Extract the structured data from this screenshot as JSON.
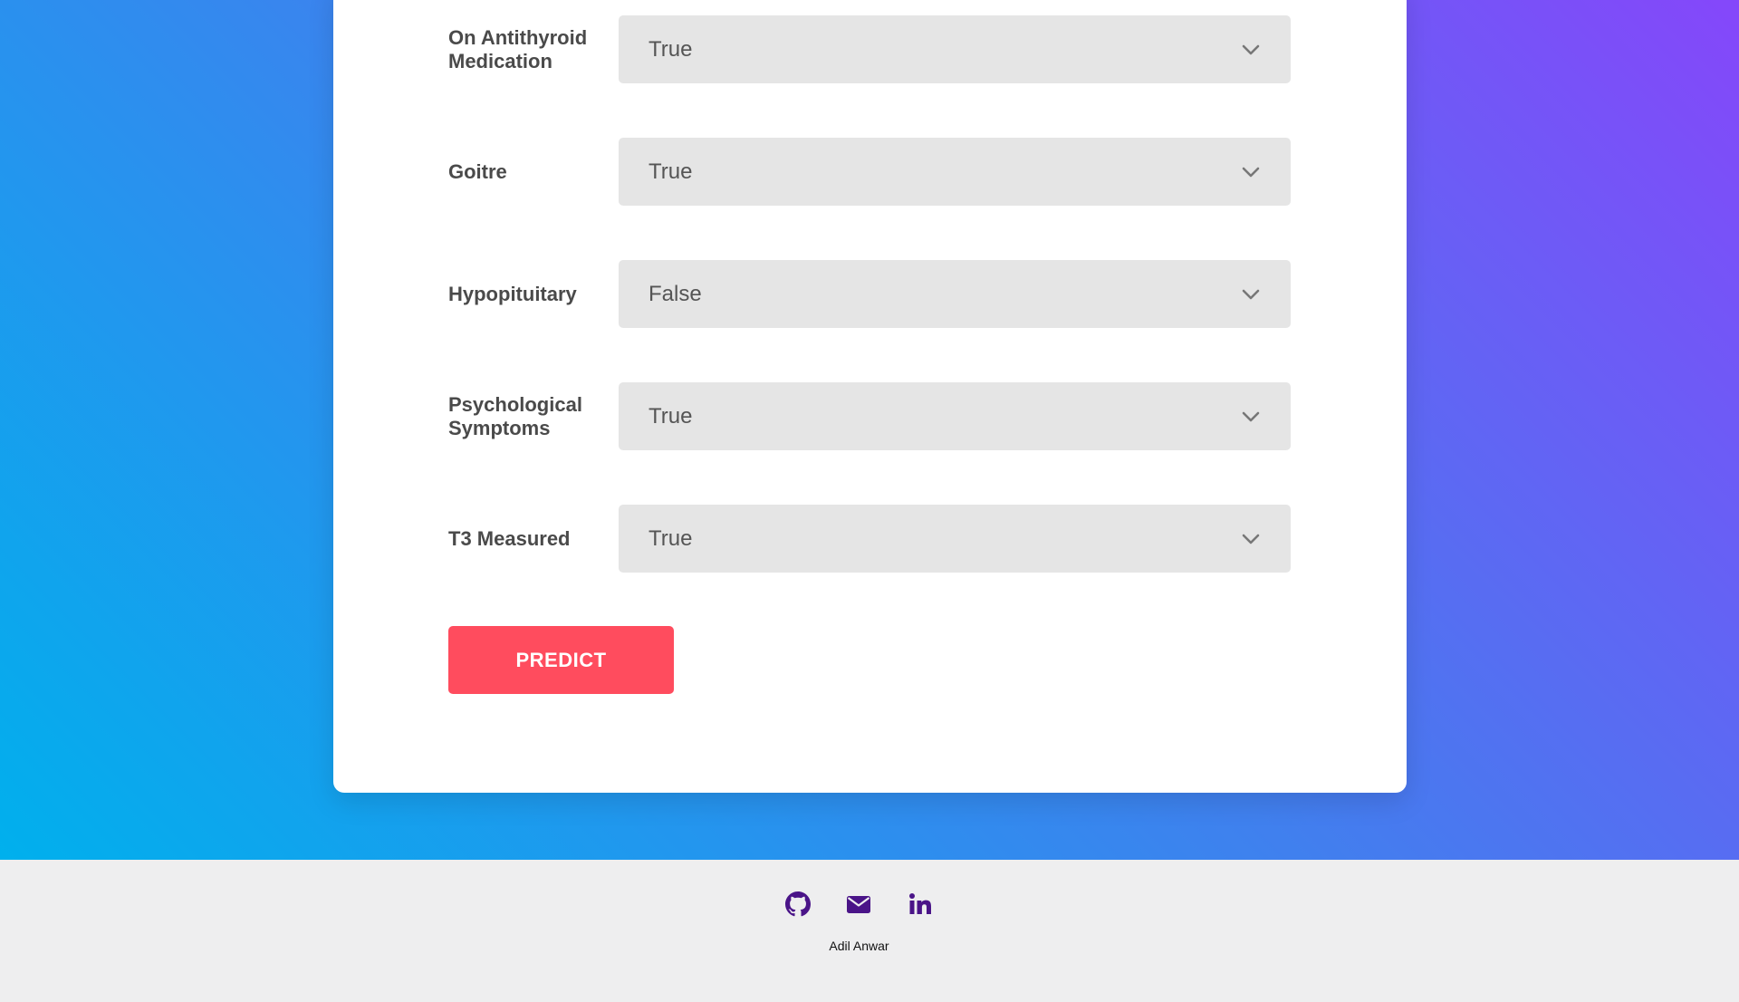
{
  "form": {
    "fields": [
      {
        "label": "On Antithyroid Medication",
        "value": "True"
      },
      {
        "label": "Goitre",
        "value": "True"
      },
      {
        "label": "Hypopituitary",
        "value": "False"
      },
      {
        "label": "Psychological Symptoms",
        "value": "True"
      },
      {
        "label": "T3 Measured",
        "value": "True"
      }
    ],
    "submit_label": "PREDICT"
  },
  "footer": {
    "icons": [
      "github-icon",
      "envelope-icon",
      "linkedin-icon"
    ],
    "author": "Adil Anwar"
  },
  "colors": {
    "gradient_start": "#00b0ed",
    "gradient_end": "#8547fa",
    "button": "#ff4c5e",
    "icon": "#4a1488",
    "select_bg": "#e5e5e5"
  }
}
